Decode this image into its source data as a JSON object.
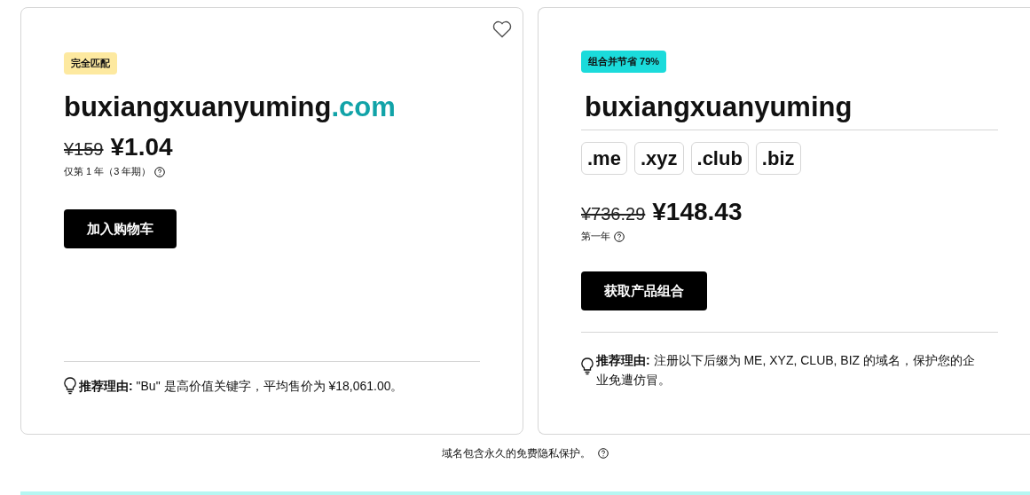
{
  "cards": [
    {
      "kind": "exact",
      "badge": "完全匹配",
      "color": "#fde9a0",
      "name": "buxiangxuanyuming",
      "tld": ".com",
      "old_price": "¥159",
      "price": "¥1.04",
      "term": "仅第 1 年（3 年期）",
      "button": "加入购物车",
      "reason": "**推荐理由:** \"Bu\" 是高价值关键字，平均售价为 ¥18,061.00。"
    },
    {
      "kind": "bundle",
      "badge": "组合并节省 79%",
      "color": "#1bdbdb",
      "name": "buxiangxuanyuming",
      "tlds": [
        ".me",
        ".xyz",
        ".club",
        ".biz"
      ],
      "old_price": "¥736.29",
      "price": "¥148.43",
      "term": "第一年",
      "button": "获取产品组合",
      "reason": "**推荐理由:** 注册以下后缀为 ME, XYZ, CLUB, BIZ 的域名，保护您的企业免遭仿冒。"
    }
  ],
  "footer": "域名包含永久的免费隐私保护。"
}
